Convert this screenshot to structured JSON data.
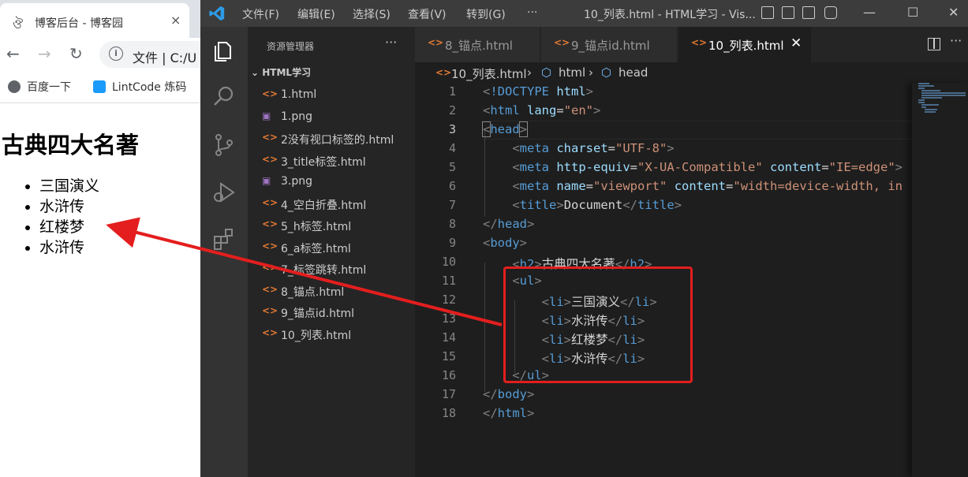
{
  "browser": {
    "tab_title": "博客后台 - 博客园",
    "close_glyph": "×",
    "address_prefix": "文件",
    "address_text": "C:/U",
    "bookmarks": [
      {
        "label": "百度一下",
        "color": "#5f6368"
      },
      {
        "label": "LintCode 炼码",
        "color": "#1a9bfc"
      }
    ],
    "page": {
      "heading": "古典四大名著",
      "items": [
        "三国演义",
        "水浒传",
        "红楼梦",
        "水浒传"
      ]
    }
  },
  "vscode": {
    "menus": [
      "文件(F)",
      "编辑(E)",
      "选择(S)",
      "查看(V)",
      "转到(G)",
      "···"
    ],
    "window_title": "10_列表.html - HTML学习 - Vis...",
    "sidebar": {
      "header": "资源管理器",
      "more": "···",
      "folder": "HTML学习",
      "files": [
        {
          "name": "1.html",
          "kind": "html"
        },
        {
          "name": "1.png",
          "kind": "image"
        },
        {
          "name": "2没有视口标签的.html",
          "kind": "html"
        },
        {
          "name": "3_title标签.html",
          "kind": "html"
        },
        {
          "name": "3.png",
          "kind": "image"
        },
        {
          "name": "4_空白折叠.html",
          "kind": "html"
        },
        {
          "name": "5_h标签.html",
          "kind": "html"
        },
        {
          "name": "6_a标签.html",
          "kind": "html"
        },
        {
          "name": "7_标签跳转.html",
          "kind": "html"
        },
        {
          "name": "8_锚点.html",
          "kind": "html"
        },
        {
          "name": "9_锚点id.html",
          "kind": "html"
        },
        {
          "name": "10_列表.html",
          "kind": "html"
        }
      ]
    },
    "tabs": [
      {
        "label": "8_锚点.html",
        "active": false
      },
      {
        "label": "9_锚点id.html",
        "active": false
      },
      {
        "label": "10_列表.html",
        "active": true
      }
    ],
    "tab_close": "✕",
    "tab_more": "···",
    "breadcrumb": [
      "10_列表.html",
      "html",
      "head"
    ],
    "file_icon_glyph": "<>",
    "current_line": 3,
    "code_lines": [
      "1",
      "2",
      "3",
      "4",
      "5",
      "6",
      "7",
      "8",
      "9",
      "10",
      "11",
      "12",
      "13",
      "14",
      "15",
      "16",
      "17",
      "18"
    ],
    "code": {
      "doctype_kw": "!DOCTYPE",
      "doctype_val": "html",
      "html_tag": "html",
      "lang_attr": "lang",
      "lang_val": "\"en\"",
      "head_tag": "head",
      "meta_tag": "meta",
      "charset_attr": "charset",
      "charset_val": "\"UTF-8\"",
      "http_equiv_attr": "http-equiv",
      "http_equiv_val": "\"X-UA-Compatible\"",
      "content_attr": "content",
      "ie_edge_val": "\"IE=edge\"",
      "name_attr": "name",
      "viewport_val": "\"viewport\"",
      "viewport_content_val": "\"width=device-width, in",
      "title_tag": "title",
      "title_text": "Document",
      "body_tag": "body",
      "h2_tag": "h2",
      "h2_text": "古典四大名著",
      "ul_tag": "ul",
      "li_tag": "li",
      "li_items": [
        "三国演义",
        "水浒传",
        "红楼梦",
        "水浒传"
      ]
    },
    "annotation_color": "#e41e1e"
  }
}
